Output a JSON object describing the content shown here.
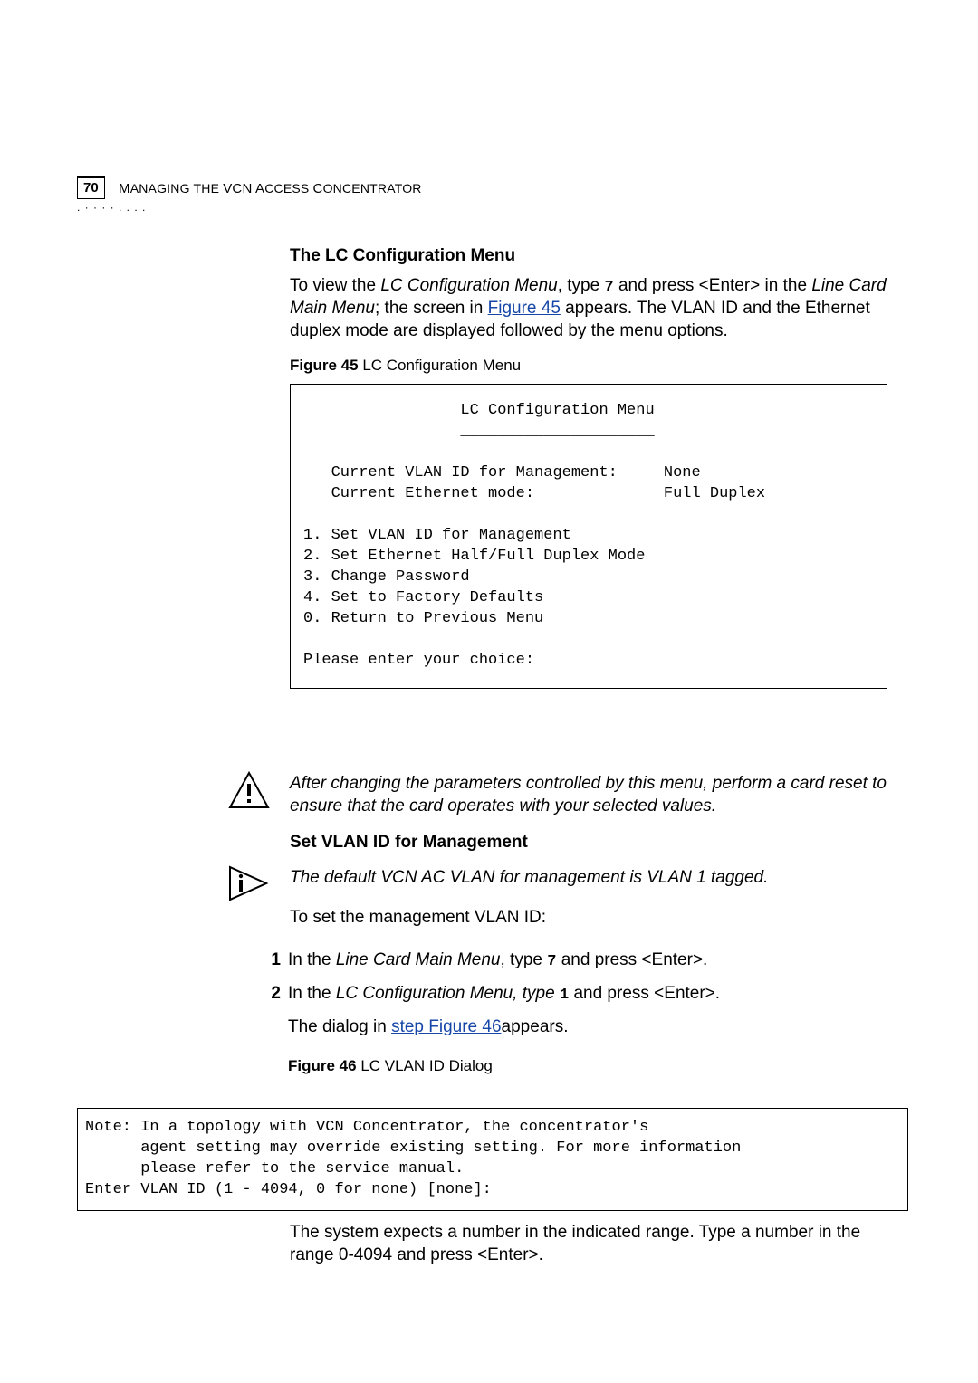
{
  "page_number": "70",
  "running_header": {
    "pre": "M",
    "mid1": "ANAGING THE",
    "vcn": "VCN A",
    "mid2": "CCESS",
    "c": "C",
    "end": "ONCENTRATOR"
  },
  "s1_title": "The LC Configuration Menu",
  "s1_p1a": "To view the ",
  "s1_p1_em1": "LC Configuration Menu",
  "s1_p1b": ", type ",
  "s1_p1_code": "7",
  "s1_p1c": " and press <Enter> in the ",
  "s1_p1_em2": "Line Card Main Menu",
  "s1_p1d": "; the screen in ",
  "s1_p1_link": "Figure 45",
  "s1_p1e": " appears. The VLAN ID and the Ethernet duplex mode are displayed followed by the menu options.",
  "fig45_label": "Figure 45",
  "fig45_caption": "   LC Configuration Menu",
  "codebox1": "                 LC Configuration Menu\n                 _____________________\n\n   Current VLAN ID for Management:     None\n   Current Ethernet mode:              Full Duplex\n\n1. Set VLAN ID for Management\n2. Set Ethernet Half/Full Duplex Mode\n3. Change Password\n4. Set to Factory Defaults\n0. Return to Previous Menu\n\nPlease enter your choice:",
  "caution_text": "After changing the parameters controlled by this menu, perform a card reset to ensure that the card operates with your selected values.",
  "s2_title": "Set VLAN ID for Management",
  "info_text": "The default VCN AC VLAN for management is VLAN 1 tagged.",
  "s2_intro": "To set the management VLAN ID:",
  "step1_a": "In the ",
  "step1_em": "Line Card Main Menu",
  "step1_b": ", type ",
  "step1_code": "7",
  "step1_c": " and press <Enter>.",
  "step2_a": "In the ",
  "step2_em": "LC Configuration Menu, type ",
  "step2_code": "1",
  "step2_b": " and press <Enter>.",
  "step2_sub_a": "The dialog in ",
  "step2_sub_link": "step Figure 46",
  "step2_sub_b": "appears.",
  "fig46_label": "Figure 46",
  "fig46_caption": "   LC VLAN ID Dialog",
  "codebox2": "Note: In a topology with VCN Concentrator, the concentrator's\n      agent setting may override existing setting. For more information\n      please refer to the service manual.\nEnter VLAN ID (1 - 4094, 0 for none) [none]:",
  "final_text": "The system expects a number in the indicated range. Type a number in the range 0-4094 and press <Enter>.",
  "chart_data": {
    "type": "table",
    "title": "LC Configuration Menu state and options",
    "status_fields": [
      {
        "label": "Current VLAN ID for Management",
        "value": "None"
      },
      {
        "label": "Current Ethernet mode",
        "value": "Full Duplex"
      }
    ],
    "menu_options": [
      {
        "number": 1,
        "label": "Set VLAN ID for Management"
      },
      {
        "number": 2,
        "label": "Set Ethernet Half/Full Duplex Mode"
      },
      {
        "number": 3,
        "label": "Change Password"
      },
      {
        "number": 4,
        "label": "Set to Factory Defaults"
      },
      {
        "number": 0,
        "label": "Return to Previous Menu"
      }
    ],
    "vlan_id_dialog": {
      "range_min": 1,
      "range_max": 4094,
      "none_value": 0,
      "default": "none"
    }
  }
}
